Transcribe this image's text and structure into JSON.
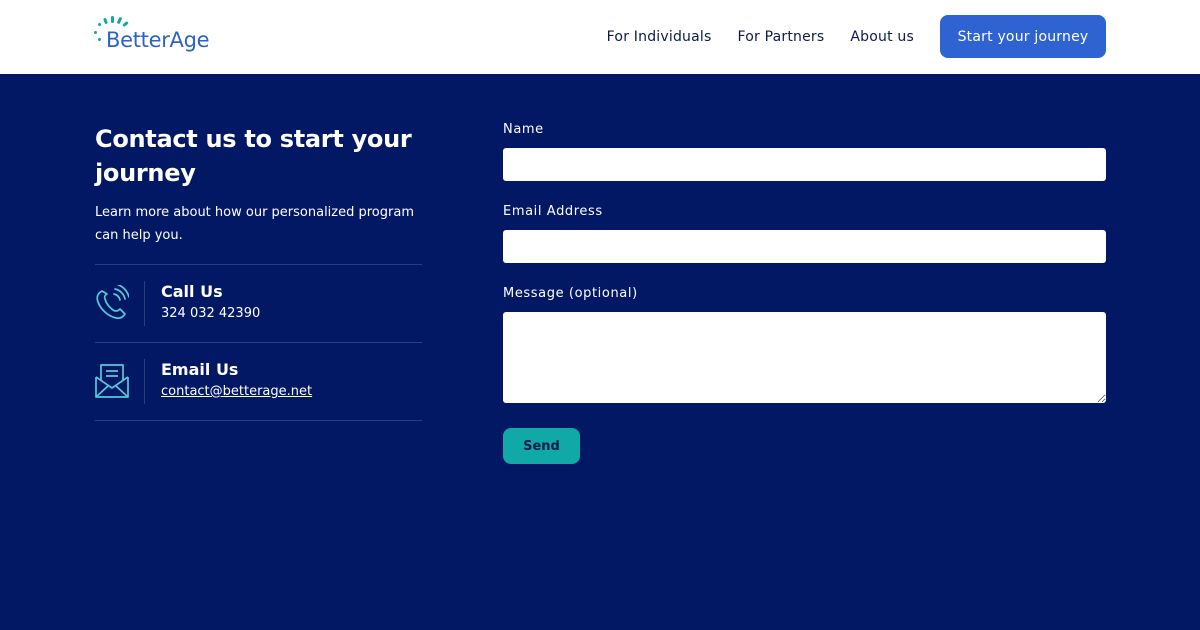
{
  "header": {
    "logo_text": "BetterAge",
    "nav": [
      {
        "label": "For Individuals"
      },
      {
        "label": "For Partners"
      },
      {
        "label": "About us"
      }
    ],
    "cta_label": "Start your journey"
  },
  "contact": {
    "headline": "Contact us to start your journey",
    "intro": "Learn more about how our personalized program can help you.",
    "call": {
      "title": "Call Us",
      "value": "324 032 42390",
      "icon": "phone-icon"
    },
    "email": {
      "title": "Email Us",
      "value": "contact@betterage.net",
      "icon": "envelope-icon"
    }
  },
  "form": {
    "name_label": "Name",
    "email_label": "Email Address",
    "message_label": "Message (optional)",
    "send_label": "Send"
  },
  "colors": {
    "background": "#031865",
    "primary_blue": "#2f63d2",
    "teal": "#11a9a8",
    "logo_blue": "#2d62c6"
  }
}
